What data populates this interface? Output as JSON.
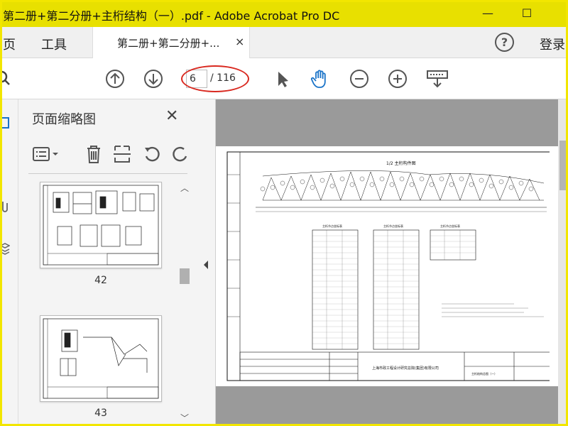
{
  "window": {
    "title": "第二册+第二分册+主桁结构（一）.pdf - Adobe Acrobat Pro DC",
    "minimize_glyph": "—",
    "maximize_glyph": "☐"
  },
  "menubar": {
    "home_label": "页",
    "tools_label": "工具",
    "doc_tab_label": "第二册+第二分册+...",
    "doc_tab_close": "×",
    "help_glyph": "?",
    "signin_label": "登录"
  },
  "toolbar": {
    "page_current": "6",
    "page_total": "/ 116",
    "icons": [
      "prev-page-icon",
      "next-page-icon",
      "select-cursor-icon",
      "hand-tool-icon",
      "zoom-out-icon",
      "zoom-in-icon",
      "keyboard-icon"
    ]
  },
  "thumbnails_panel": {
    "title": "页面缩略图",
    "close_glyph": "✕",
    "pages": [
      {
        "label": "42"
      },
      {
        "label": "43"
      }
    ]
  },
  "document": {
    "drawing_title": "1/2 主桁构件图",
    "table_titles": [
      "主桁节点坐标表",
      "主桁节点坐标表",
      "主桁节点坐标表"
    ],
    "company": "上海市政工程设计研究总院(集团)有限公司",
    "sheet_name": "主桁结构总图（一）"
  },
  "colors": {
    "title_bar": "#e8e000",
    "annotation_oval": "#d9281f",
    "doc_background": "#9a9a9a"
  }
}
